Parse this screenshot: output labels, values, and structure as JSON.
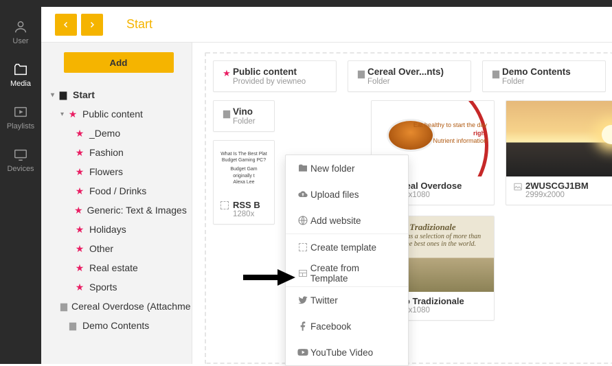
{
  "rail": {
    "items": [
      {
        "label": "User"
      },
      {
        "label": "Media"
      },
      {
        "label": "Playlists"
      },
      {
        "label": "Devices"
      }
    ]
  },
  "header": {
    "breadcrumb": "Start"
  },
  "sidebar": {
    "add_label": "Add",
    "root": "Start",
    "public": "Public content",
    "pubs": [
      "_Demo",
      "Fashion",
      "Flowers",
      "Food / Drinks",
      "Generic: Text & Images",
      "Holidays",
      "Other",
      "Real estate",
      "Sports"
    ],
    "folders": [
      "Cereal Overdose (Attachme",
      "Demo Contents"
    ]
  },
  "cards": {
    "public": {
      "title": "Public content",
      "sub": "Provided by viewneo"
    },
    "cereal_folder": {
      "title": "Cereal Over...nts)",
      "sub": "Folder"
    },
    "demo_folder": {
      "title": "Demo Contents",
      "sub": "Folder"
    },
    "vino_folder": {
      "title": "Vino",
      "sub": "Folder"
    },
    "rss": {
      "title": "RSS B",
      "sub": "1280x",
      "img_t1": "What Is The Best Plat",
      "img_t2": "Budget Gaming PC?",
      "img_t3": "Budget Gam",
      "img_t4": "originally t",
      "img_t5": "Alexa Lee"
    },
    "cereal_item": {
      "foot_title": "Cereal Overdose",
      "foot_sub": "1920x1080",
      "img_t1": "Eat healthy to start the day",
      "img_t2": "right",
      "img_t3": "Nutrient information"
    },
    "vino_item": {
      "foot_title": "Vino Tradizionale",
      "foot_sub": "1920x1080",
      "img_t1": "Tradizionale",
      "img_t2": "d contains a selection of more than",
      "img_t3": "es of the best ones in the world."
    },
    "sunset": {
      "foot_title": "2WUSCGJ1BM",
      "foot_sub": "2999x2000"
    }
  },
  "menu": {
    "new_folder": "New folder",
    "upload": "Upload files",
    "website": "Add website",
    "create_template": "Create template",
    "from_template": "Create from Template",
    "twitter": "Twitter",
    "facebook": "Facebook",
    "youtube": "YouTube Video"
  }
}
